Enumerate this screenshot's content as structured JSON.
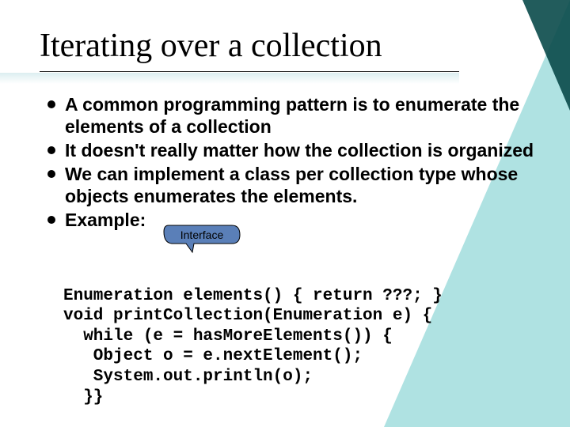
{
  "title": "Iterating over a collection",
  "bullets": [
    "A common programming pattern is to enumerate the elements of a collection",
    "It doesn't really matter how the collection is organized",
    "We can implement a class per collection type whose objects enumerates the elements.",
    "Example:"
  ],
  "callout": {
    "label": "Interface"
  },
  "code": {
    "l1": "Enumeration elements() { return ???; }",
    "l2": "void printCollection(Enumeration e) {",
    "l3": "  while (e = hasMoreElements()) {",
    "l4": "   Object o = e.nextElement();",
    "l5": "   System.out.println(o);",
    "l6": "  }}"
  }
}
